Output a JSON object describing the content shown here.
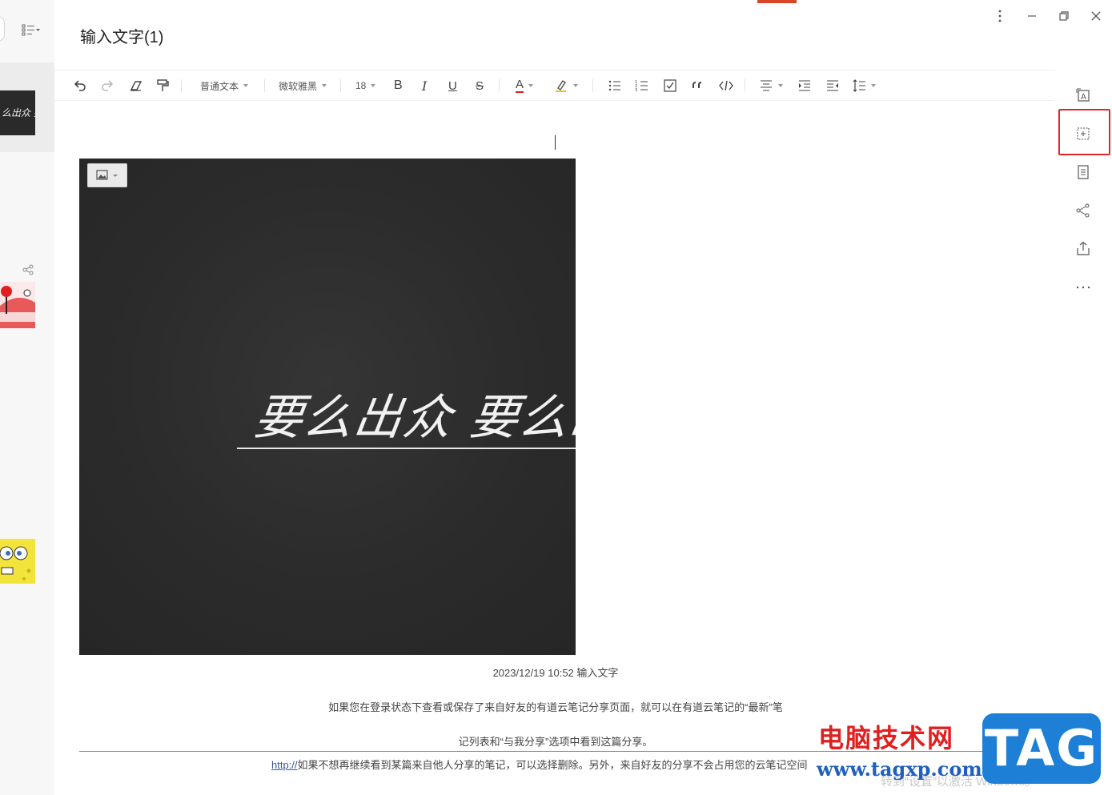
{
  "note_title": "输入文字(1)",
  "toolbar": {
    "paragraph_style": "普通文本",
    "font_family": "微软雅黑",
    "font_size": "18",
    "bold": "B",
    "italic": "I",
    "underline": "U",
    "strikethrough": "S",
    "font_color": "A"
  },
  "image_text": "要么出众 要么出局",
  "content": {
    "caption": "2023/12/19 10:52 输入文字",
    "para1": "如果您在登录状态下查看或保存了来自好友的有道云笔记分享页面，就可以在有道云笔记的“最新”笔",
    "para2": "记列表和“与我分享”选项中看到这篇分享。",
    "link": "http://",
    "para3": "如果不想再继续看到某篇来自他人分享的笔记，可以选择删除。另外，来自好友的分享不会占用您的云笔记空间"
  },
  "watermark": {
    "site_name": "电脑技术网",
    "url": "www.tagxp.com",
    "tag": "TAG",
    "activate_windows": "转到“设置”以激活 Windows。"
  },
  "colors": {
    "highlight_box": "#e0262a",
    "accent_red": "#d9472b",
    "watermark_blue": "#1e7fd6"
  }
}
